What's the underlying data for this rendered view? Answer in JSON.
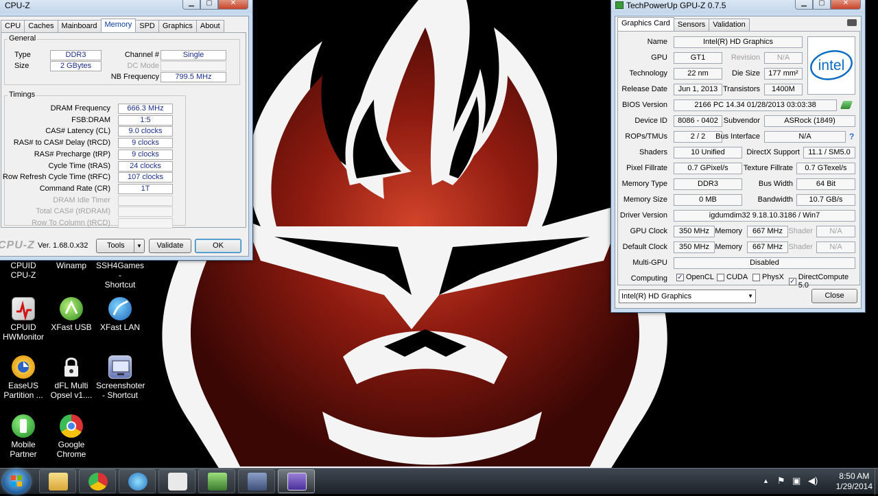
{
  "desktop": {
    "icons": [
      {
        "label": "CPUID\nCPU-Z"
      },
      {
        "label": "Winamp"
      },
      {
        "label": "SSH4Games -\nShortcut"
      },
      {
        "label": "CPUID\nHWMonitor"
      },
      {
        "label": "XFast USB"
      },
      {
        "label": "XFast LAN"
      },
      {
        "label": "EaseUS\nPartition ..."
      },
      {
        "label": "dFL Multi\nOpsel v1...."
      },
      {
        "label": "Screenshoter\n- Shortcut"
      },
      {
        "label": "Mobile\nPartner"
      },
      {
        "label": "Google\nChrome"
      }
    ]
  },
  "cpuz": {
    "title": "CPU-Z",
    "tabs": [
      "CPU",
      "Caches",
      "Mainboard",
      "Memory",
      "SPD",
      "Graphics",
      "About"
    ],
    "active_tab": "Memory",
    "general": {
      "title": "General",
      "type_label": "Type",
      "type_value": "DDR3",
      "size_label": "Size",
      "size_value": "2 GBytes",
      "channel_label": "Channel #",
      "channel_value": "Single",
      "dcmode_label": "DC Mode",
      "dcmode_value": "",
      "nbfreq_label": "NB Frequency",
      "nbfreq_value": "799.5 MHz"
    },
    "timings": {
      "title": "Timings",
      "rows": [
        {
          "label": "DRAM Frequency",
          "value": "666.3 MHz",
          "enabled": true
        },
        {
          "label": "FSB:DRAM",
          "value": "1:5",
          "enabled": true
        },
        {
          "label": "CAS# Latency (CL)",
          "value": "9.0 clocks",
          "enabled": true
        },
        {
          "label": "RAS# to CAS# Delay (tRCD)",
          "value": "9 clocks",
          "enabled": true
        },
        {
          "label": "RAS# Precharge (tRP)",
          "value": "9 clocks",
          "enabled": true
        },
        {
          "label": "Cycle Time (tRAS)",
          "value": "24 clocks",
          "enabled": true
        },
        {
          "label": "Row Refresh Cycle Time (tRFC)",
          "value": "107 clocks",
          "enabled": true
        },
        {
          "label": "Command Rate (CR)",
          "value": "1T",
          "enabled": true
        },
        {
          "label": "DRAM Idle Timer",
          "value": "",
          "enabled": false
        },
        {
          "label": "Total CAS# (tRDRAM)",
          "value": "",
          "enabled": false
        },
        {
          "label": "Row To Column (tRCD)",
          "value": "",
          "enabled": false
        }
      ]
    },
    "footer": {
      "brand": "CPU-Z",
      "version": "Ver. 1.68.0.x32",
      "tools_label": "Tools",
      "validate_label": "Validate",
      "ok_label": "OK"
    }
  },
  "gpuz": {
    "title": "TechPowerUp GPU-Z 0.7.5",
    "tabs": [
      "Graphics Card",
      "Sensors",
      "Validation"
    ],
    "active_tab": "Graphics Card",
    "logo_text": "intel",
    "name_label": "Name",
    "name_value": "Intel(R) HD Graphics",
    "gpu_label": "GPU",
    "gpu_value": "GT1",
    "revision_label": "Revision",
    "revision_value": "N/A",
    "tech_label": "Technology",
    "tech_value": "22 nm",
    "diesize_label": "Die Size",
    "diesize_value": "177 mm²",
    "release_label": "Release Date",
    "release_value": "Jun 1, 2013",
    "transistors_label": "Transistors",
    "transistors_value": "1400M",
    "bios_label": "BIOS Version",
    "bios_value": "2166 PC 14.34  01/28/2013  03:03:38",
    "deviceid_label": "Device ID",
    "deviceid_value": "8086 - 0402",
    "subvendor_label": "Subvendor",
    "subvendor_value": "ASRock (1849)",
    "rops_label": "ROPs/TMUs",
    "rops_value": "2 / 2",
    "bus_label": "Bus Interface",
    "bus_value": "N/A",
    "shaders_label": "Shaders",
    "shaders_value": "10 Unified",
    "dx_label": "DirectX Support",
    "dx_value": "11.1 / SM5.0",
    "pixel_label": "Pixel Fillrate",
    "pixel_value": "0.7 GPixel/s",
    "texture_label": "Texture Fillrate",
    "texture_value": "0.7 GTexel/s",
    "memtype_label": "Memory Type",
    "memtype_value": "DDR3",
    "buswidth_label": "Bus Width",
    "buswidth_value": "64 Bit",
    "memsize_label": "Memory Size",
    "memsize_value": "0 MB",
    "bandwidth_label": "Bandwidth",
    "bandwidth_value": "10.7 GB/s",
    "driver_label": "Driver Version",
    "driver_value": "igdumdim32 9.18.10.3186 / Win7",
    "gpuclock_label": "GPU Clock",
    "gpuclock_value": "350 MHz",
    "memory_label": "Memory",
    "memclock_value": "667 MHz",
    "shader_label": "Shader",
    "shader_value": "N/A",
    "defclock_label": "Default Clock",
    "defclock_value": "350 MHz",
    "defmem_value": "667 MHz",
    "defshader_value": "N/A",
    "multigpu_label": "Multi-GPU",
    "multigpu_value": "Disabled",
    "computing_label": "Computing",
    "computing": [
      {
        "label": "OpenCL",
        "checked": true
      },
      {
        "label": "CUDA",
        "checked": false
      },
      {
        "label": "PhysX",
        "checked": false
      },
      {
        "label": "DirectCompute 5.0",
        "checked": true
      }
    ],
    "selected_card": "Intel(R) HD Graphics",
    "close_label": "Close"
  },
  "taskbar": {
    "time": "8:50 AM",
    "date": "1/29/2014"
  }
}
